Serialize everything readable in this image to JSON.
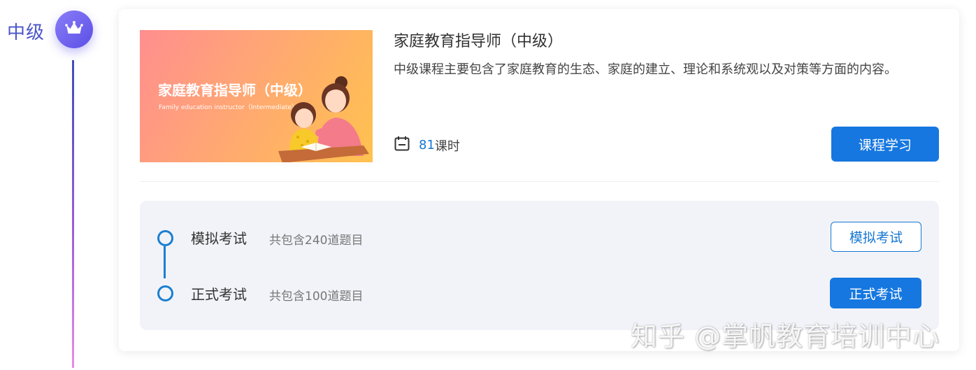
{
  "level": {
    "label": "中级",
    "badge_icon": "crown-icon"
  },
  "course": {
    "cover_title": "家庭教育指导师（中级）",
    "cover_subtitle": "Family education instructor（Intermediate）",
    "title": "家庭教育指导师（中级）",
    "description": "中级课程主要包含了家庭教育的生态、家庭的建立、理论和系统观以及对策等方面的内容。",
    "hours_value": "81",
    "hours_unit": "课时",
    "study_button": "课程学习"
  },
  "exams": [
    {
      "name": "模拟考试",
      "count": "共包含240道题目",
      "button": "模拟考试"
    },
    {
      "name": "正式考试",
      "count": "共包含100道题目",
      "button": "正式考试"
    }
  ],
  "watermark": "知乎 @掌帆教育培训中心",
  "colors": {
    "accent": "#1677e0",
    "badge": "#6b5ff0",
    "panel_bg": "#f2f3f8"
  }
}
